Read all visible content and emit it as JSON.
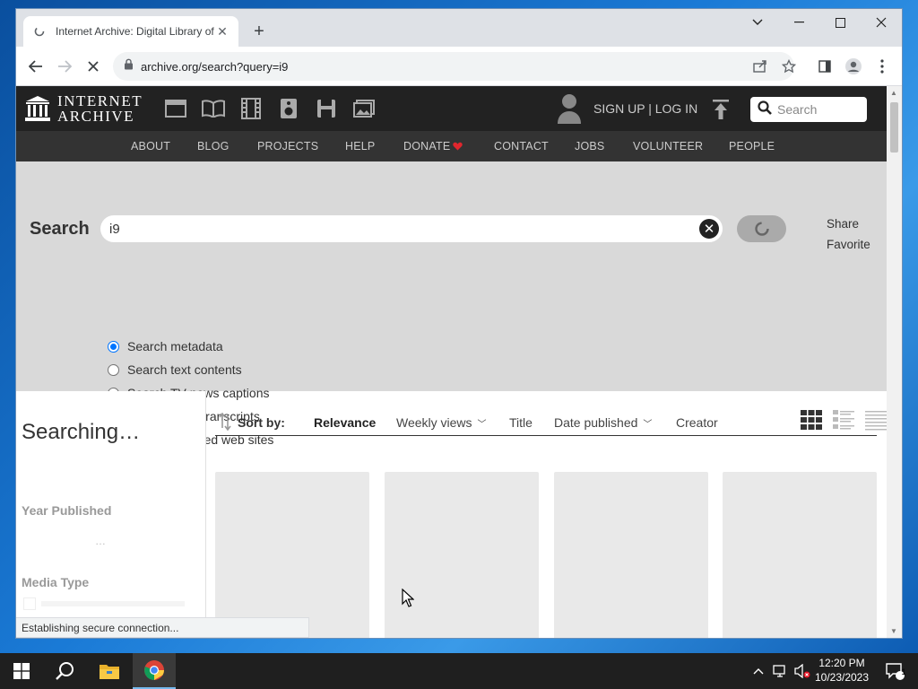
{
  "browser": {
    "tab_title": "Internet Archive: Digital Library of Free & Borrowable Books, Movies, Music & Wayback Machine",
    "url": "archive.org/search?query=i9",
    "status_text": "Establishing secure connection..."
  },
  "ia": {
    "logo_line1": "INTERNET",
    "logo_line2": "ARCHIVE",
    "signup_login": "SIGN UP | LOG IN",
    "search_placeholder": "Search",
    "media_icons": [
      "web-icon",
      "texts-icon",
      "video-icon",
      "audio-icon",
      "software-icon",
      "images-icon"
    ],
    "nav": [
      "ABOUT",
      "BLOG",
      "PROJECTS",
      "HELP",
      "DONATE",
      "CONTACT",
      "JOBS",
      "VOLUNTEER",
      "PEOPLE"
    ]
  },
  "search": {
    "label": "Search",
    "query": "i9",
    "share": "Share",
    "favorite": "Favorite",
    "options": [
      {
        "label": "Search metadata",
        "checked": true
      },
      {
        "label": "Search text contents",
        "checked": false
      },
      {
        "label": "Search TV news captions",
        "checked": false
      },
      {
        "label": "Search radio transcripts",
        "checked": false
      },
      {
        "label": "Search archived web sites",
        "checked": false
      }
    ]
  },
  "results": {
    "status": "Searching…",
    "facets": [
      "Year Published",
      "Media Type"
    ],
    "loading_dots": "…",
    "sort_by_label": "Sort by:",
    "sort_options": [
      "Relevance",
      "Weekly views",
      "Title",
      "Date published",
      "Creator"
    ],
    "active_sort": "Relevance"
  },
  "taskbar": {
    "time": "12:20 PM",
    "date": "10/23/2023",
    "notification_count": "1"
  },
  "colors": {
    "ia_header": "#222222",
    "ia_nav": "#333333",
    "search_area": "#d9d9d9",
    "radio_accent": "#0075ff",
    "donate_heart": "#e0262d"
  }
}
